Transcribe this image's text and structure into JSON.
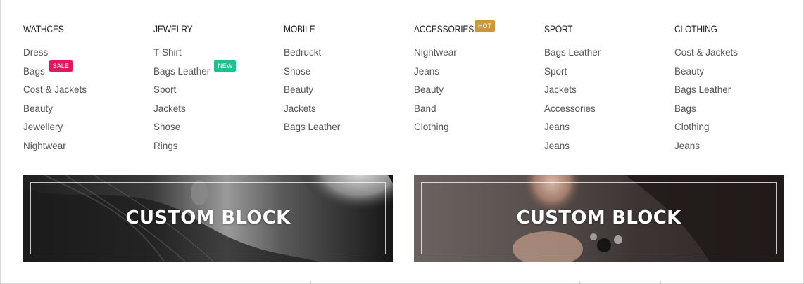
{
  "columns": [
    {
      "heading": "WATHCES",
      "links": [
        "Dress",
        "Bags",
        "Cost & Jackets",
        "Beauty",
        "Jewellery",
        "Nightwear"
      ],
      "badge": {
        "index": 1,
        "label": "SALE",
        "kind": "sale"
      }
    },
    {
      "heading": "JEWELRY",
      "links": [
        "T-Shirt",
        "Bags Leather",
        "Sport",
        "Jackets",
        "Shose",
        "Rings"
      ],
      "badge": {
        "index": 1,
        "label": "NEW",
        "kind": "new"
      }
    },
    {
      "heading": "MOBILE",
      "links": [
        "Bedruckt",
        "Shose",
        "Beauty",
        "Jackets",
        "Bags Leather"
      ]
    },
    {
      "heading": "ACCESSORIES",
      "heading_badge": "HOT",
      "links": [
        "Nightwear",
        "Jeans",
        "Beauty",
        "Band",
        "Clothing"
      ]
    },
    {
      "heading": "SPORT",
      "links": [
        "Bags Leather",
        "Sport",
        "Jackets",
        "Accessories",
        "Jeans",
        "Jeans"
      ]
    },
    {
      "heading": "CLOTHING",
      "links": [
        "Cost & Jackets",
        "Beauty",
        "Bags Leather",
        "Bags",
        "Clothing",
        "Jeans"
      ]
    }
  ],
  "banners": [
    {
      "title": "CUSTOM BLOCK"
    },
    {
      "title": "CUSTOM BLOCK"
    }
  ],
  "colors": {
    "sale_badge": "#e5175c",
    "new_badge": "#1fbf8f",
    "hot_badge": "#c99a3c",
    "link_text": "#555555",
    "heading_text": "#222222"
  }
}
